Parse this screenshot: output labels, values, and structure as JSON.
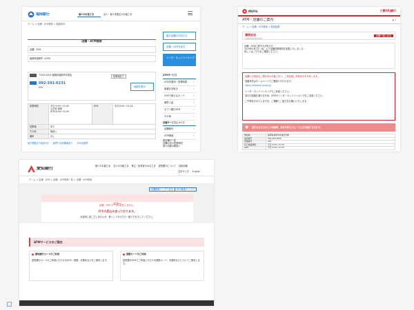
{
  "p1": {
    "logo_text": "福岡銀行",
    "nav": [
      "個人のお客さま",
      "法人・個人事業主のお客さま"
    ],
    "breadcrumb": "ホーム > 店舗・ATM検索 > 福岡県内",
    "heading": "店舗・ATM検索",
    "area_label": "店舗・ATM",
    "result_label": "福岡県福岡市（ATM）",
    "address": "〒000-0000 福岡県福岡市中央区",
    "tel": "092-291-6231",
    "branch_code": "050",
    "badge": "駐車場あり",
    "map_button": "地図を表示",
    "hours_header": "営業時間",
    "hours_lines": [
      "平日 9:00〜15:00",
      "土日祝 休業",
      "ATM 8:00〜21:00"
    ],
    "atm_header": "ATM",
    "atm_value": "平日 8:00〜21:00",
    "parking_header": "駐車場",
    "parking_value": "あり",
    "other_header": "その他",
    "other_value": "取扱い",
    "extra_header": "備考",
    "extra_value": "なし",
    "footer_links": [
      "地下鉄駅より徒歩5分",
      "最寄りの駐車場あり",
      "ATM出張所"
    ],
    "side_buttons": [
      "取引店舗のお知らせ",
      "店舗・ATMを探す",
      "インターネットバンキング"
    ],
    "side_title": "ATMサービス",
    "side_items": [
      "ATM手数料・営業時間",
      "各種お手続き",
      "ATMで使えるカード",
      "硬貨入金",
      "セブン銀行ATM",
      "その他"
    ],
    "side_title2": "各種サービスについて",
    "side_items2": [
      "店舗案内",
      "ATM検索"
    ],
    "side_footer": [
      "各店舗の一覧",
      "店舗の窓口営業時間",
      "個人情報の取扱い"
    ]
  },
  "p2": {
    "logo_text": "MUFG",
    "bank_name": "三菱UFJ銀行",
    "title": "ATM・店舗のご案内",
    "breadcrumb": "ホーム > 店舗・ATM検索 > 検索結果",
    "store_name": "福岡支店",
    "store_sub": "Fukuoka Branch",
    "store_button": "店舗一覧に戻る",
    "notice_lines": [
      "店舗・ATMに関するお知らせ",
      "2019年5月1日（水）より店舗営業時間を変更いたしました。",
      "詳しくはこちらをご確認ください。"
    ],
    "alert_lines": [
      "店舗への来店をご検討中のお客さまへ：ご来店前に予約をおすすめします。",
      "混雑状況はホームページでご確認いただけます。",
      "https://www.bk.mufg.jp/",
      "インターネットバンキングもご利用ください。",
      "窓口の混雑を避けるため、ATMやインターネットバンキングをご活用ください。",
      "ご不便をおかけしますが、ご理解とご協力をお願いいたします。"
    ],
    "banner_text": "窓口のまぎらわしい時間帯、来店予約でスムーズにお手続きできます。",
    "table": [
      [
        "所在地",
        "福岡県福岡市中央区天神"
      ],
      [
        "電話番号",
        "092-000-0000"
      ],
      [
        "店舗番号",
        "000"
      ],
      [
        "窓口営業時間",
        "平日 9:00〜15:00"
      ],
      [
        "ATM",
        "平日 8:00〜21:00"
      ],
      [
        "備考",
        "駐車場なし"
      ]
    ]
  },
  "p3": {
    "logo_text": "愛知銀行",
    "top_links": [
      "個人のお客さま",
      "法人のお客さま",
      "株主・投資家のみなさま",
      "愛知銀行について",
      "採用情報"
    ],
    "lang_links": [
      "文字サイズ",
      "English"
    ],
    "breadcrumb": "ホーム > 店舗・ATM > 店舗・ATM検索一覧 > 店舗・ATM検索",
    "small_buttons": [
      "店舗検索トップへ戻る",
      "ATM検索トップへ"
    ],
    "error_title": "エラー",
    "error_sub": "店舗・ATM データが存在しません。",
    "error_main": "只今大変込み合っております。",
    "error_note": "大変申し訳ございませんが、暫くしてからもう一度アクセスしてください。",
    "atm_heading": "ATMサービスのご案内",
    "card1_title": "愛知銀行カードのご利用",
    "card1_text": "愛知銀行カードのご利用いただけるATM・時間、手数料などをご案内します。",
    "card2_title": "提携カードのご利用",
    "card2_text": "愛知銀行ATMでご利用いただける提携カード、手数料などについてご案内します。"
  },
  "colors": {
    "fukuoka_blue": "#2b74c7",
    "mufg_red": "#d3242b",
    "aichi_red": "#d9413b"
  }
}
